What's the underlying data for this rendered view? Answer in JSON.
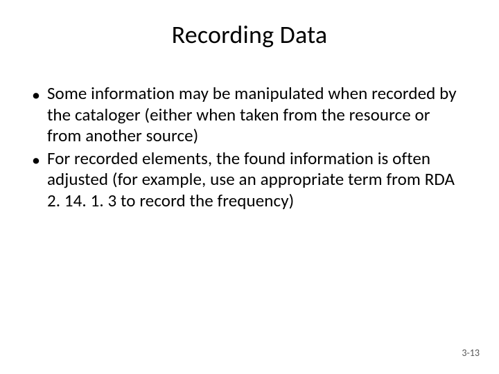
{
  "title": "Recording Data",
  "bullets": [
    "Some information may be manipulated when recorded by the cataloger (either when taken from the resource or from another source)",
    "For recorded elements, the found information is often adjusted (for example, use an appropriate term from RDA 2. 14. 1. 3 to record the frequency)"
  ],
  "page_number": "3-13"
}
